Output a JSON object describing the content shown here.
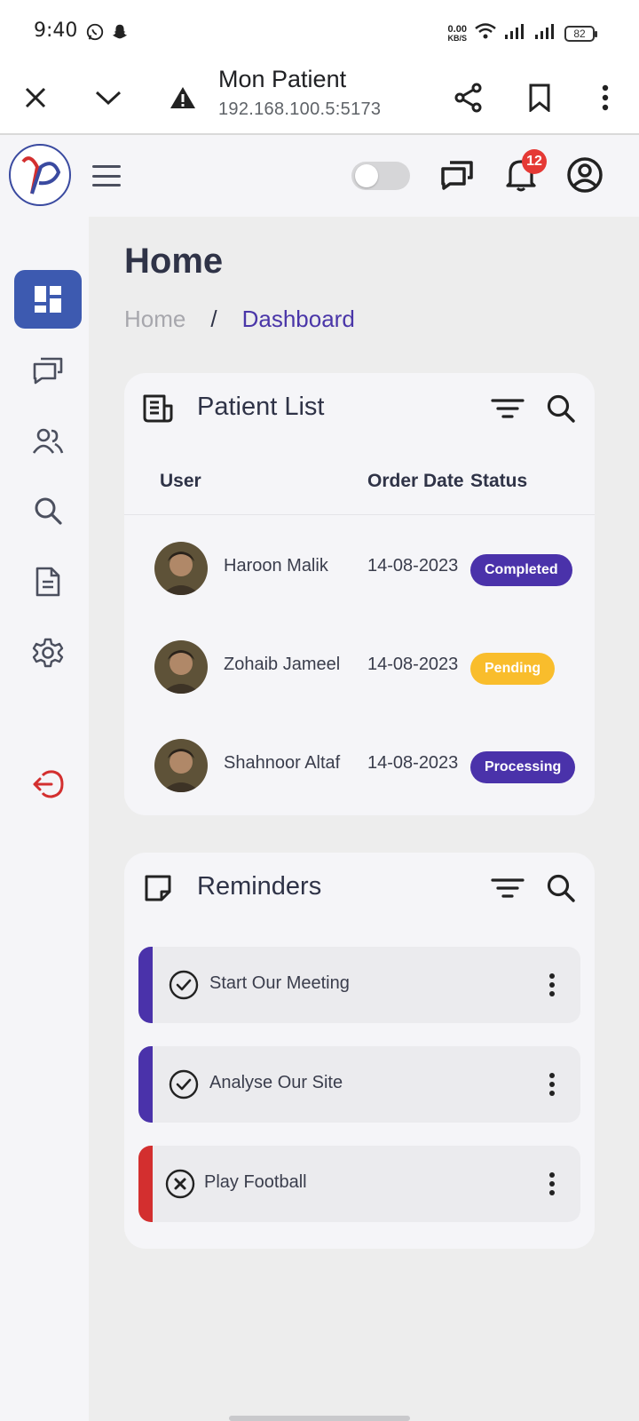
{
  "status_bar": {
    "time": "9:40",
    "net_speed_value": "0.00",
    "net_speed_unit": "KB/S",
    "battery": "82"
  },
  "browser": {
    "title": "Mon Patient",
    "url": "192.168.100.5:5173"
  },
  "header": {
    "notification_count": "12"
  },
  "page": {
    "title": "Home",
    "breadcrumb": {
      "home": "Home",
      "separator": "/",
      "current": "Dashboard"
    }
  },
  "patient_list": {
    "title": "Patient List",
    "columns": {
      "user": "User",
      "order_date": "Order Date",
      "status": "Status"
    },
    "rows": [
      {
        "name": "Haroon Malik",
        "date": "14-08-2023",
        "status": "Completed",
        "status_color": "#4a32aa"
      },
      {
        "name": "Zohaib Jameel",
        "date": "14-08-2023",
        "status": "Pending",
        "status_color": "#f9bd2c"
      },
      {
        "name": "Shahnoor Altaf",
        "date": "14-08-2023",
        "status": "Processing",
        "status_color": "#4a32aa"
      }
    ]
  },
  "reminders": {
    "title": "Reminders",
    "items": [
      {
        "text": "Start Our Meeting",
        "state": "done",
        "color": "#4a32aa"
      },
      {
        "text": "Analyse Our Site",
        "state": "done",
        "color": "#4a32aa"
      },
      {
        "text": "Play Football",
        "state": "cancelled",
        "color": "#d32f2f"
      }
    ]
  },
  "colors": {
    "accent": "#4a36a8",
    "sidebar_active": "#3d5ab0",
    "logout": "#d32f2f"
  }
}
